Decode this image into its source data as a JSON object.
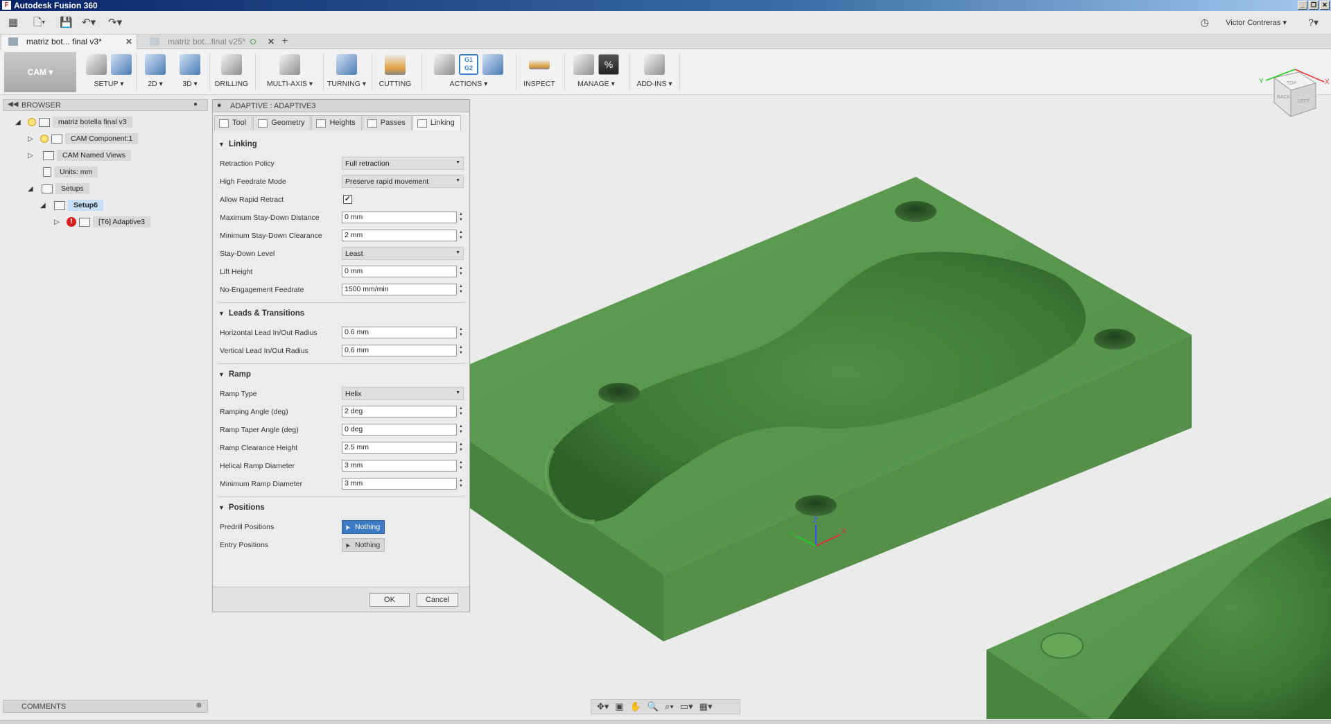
{
  "window": {
    "title": "Autodesk Fusion 360",
    "controls": [
      "_",
      "❐",
      "✕"
    ]
  },
  "qat": {
    "user": "Victor Contreras ▾",
    "help": "?▾"
  },
  "doc_tabs": [
    {
      "label": "matriz bot... final v3*",
      "active": true
    },
    {
      "label": "matriz bot...final v25*",
      "active": false
    }
  ],
  "ribbon": {
    "workspace": "CAM ▾",
    "groups": [
      {
        "label": "SETUP ▾"
      },
      {
        "label": "2D ▾"
      },
      {
        "label": "3D ▾"
      },
      {
        "label": "DRILLING"
      },
      {
        "label": "MULTI-AXIS ▾"
      },
      {
        "label": "TURNING ▾"
      },
      {
        "label": "CUTTING"
      },
      {
        "label": "ACTIONS ▾"
      },
      {
        "label": "INSPECT"
      },
      {
        "label": "MANAGE ▾"
      },
      {
        "label": "ADD-INS ▾"
      }
    ],
    "g1g2": "G1\nG2",
    "percent": "%"
  },
  "browser": {
    "title": "BROWSER",
    "items": [
      {
        "label": "matriz botella final v3"
      },
      {
        "label": "CAM Component:1"
      },
      {
        "label": "CAM Named Views"
      },
      {
        "label": "Units: mm"
      },
      {
        "label": "Setups"
      },
      {
        "label": "Setup6"
      },
      {
        "label": "[T6] Adaptive3"
      }
    ]
  },
  "dialog": {
    "title": "ADAPTIVE : ADAPTIVE3",
    "tabs": [
      "Tool",
      "Geometry",
      "Heights",
      "Passes",
      "Linking"
    ],
    "sections": {
      "linking": "Linking",
      "leads": "Leads & Transitions",
      "ramp": "Ramp",
      "positions": "Positions"
    },
    "fields": {
      "retraction_policy": {
        "label": "Retraction Policy",
        "value": "Full retraction"
      },
      "high_feedrate_mode": {
        "label": "High Feedrate Mode",
        "value": "Preserve rapid movement"
      },
      "allow_rapid_retract": {
        "label": "Allow Rapid Retract",
        "value": "✓"
      },
      "max_stay_down": {
        "label": "Maximum Stay-Down Distance",
        "value": "0 mm"
      },
      "min_stay_down": {
        "label": "Minimum Stay-Down Clearance",
        "value": "2 mm"
      },
      "stay_down_level": {
        "label": "Stay-Down Level",
        "value": "Least"
      },
      "lift_height": {
        "label": "Lift Height",
        "value": "0 mm"
      },
      "no_engagement_feedrate": {
        "label": "No-Engagement Feedrate",
        "value": "1500 mm/min"
      },
      "horizontal_lead": {
        "label": "Horizontal Lead In/Out Radius",
        "value": "0.6 mm"
      },
      "vertical_lead": {
        "label": "Vertical Lead In/Out Radius",
        "value": "0.6 mm"
      },
      "ramp_type": {
        "label": "Ramp Type",
        "value": "Helix"
      },
      "ramping_angle": {
        "label": "Ramping Angle (deg)",
        "value": "2 deg"
      },
      "ramp_taper_angle": {
        "label": "Ramp Taper Angle (deg)",
        "value": "0 deg"
      },
      "ramp_clearance_height": {
        "label": "Ramp Clearance Height",
        "value": "2.5 mm"
      },
      "helical_ramp_diameter": {
        "label": "Helical Ramp Diameter",
        "value": "3 mm"
      },
      "minimum_ramp_diameter": {
        "label": "Minimum Ramp Diameter",
        "value": "3 mm"
      },
      "predrill_positions": {
        "label": "Predrill Positions",
        "value": "Nothing"
      },
      "entry_positions": {
        "label": "Entry Positions",
        "value": "Nothing"
      }
    },
    "ok": "OK",
    "cancel": "Cancel"
  },
  "comments": {
    "title": "COMMENTS"
  },
  "viewcube": {
    "back": "BACK",
    "left": "LEFT",
    "top": "TOP",
    "x": "X",
    "y": "Y"
  },
  "axis": {
    "z": "Z",
    "x": "X",
    "y": "Y"
  },
  "colors": {
    "model_top": "#5a9a4f",
    "model_side": "#4f8a45",
    "accent": "#3d7cc4",
    "error": "#d82020"
  }
}
